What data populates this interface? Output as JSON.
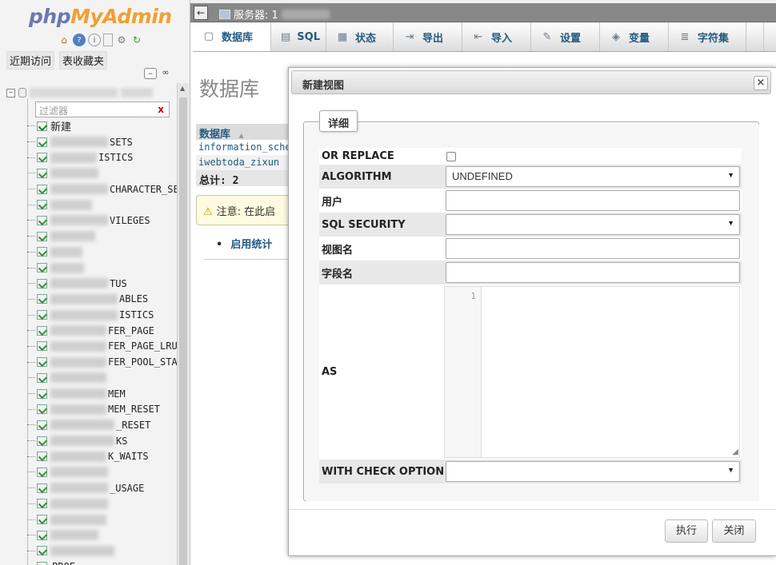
{
  "nav": {
    "logo_php": "php",
    "logo_admin": "MyAdmin",
    "icons": [
      "home-icon",
      "help-icon",
      "info-icon",
      "docs-icon",
      "settings-icon",
      "reload-icon"
    ],
    "links": [
      "近期访问",
      "表收藏夹"
    ],
    "filter_placeholder": "过滤器",
    "filter_clear": "x",
    "new_label": "新建",
    "tables": [
      {
        "visible_suffix": "SETS",
        "blur_width": 72
      },
      {
        "visible_suffix": "ISTICS",
        "blur_width": 58
      },
      {
        "visible_suffix": "",
        "blur_width": 60
      },
      {
        "visible_suffix": "CHARACTER_SE",
        "blur_width": 72
      },
      {
        "visible_suffix": "",
        "blur_width": 52
      },
      {
        "visible_suffix": "VILEGES",
        "blur_width": 72
      },
      {
        "visible_suffix": "",
        "blur_width": 56
      },
      {
        "visible_suffix": "",
        "blur_width": 40
      },
      {
        "visible_suffix": "",
        "blur_width": 42
      },
      {
        "visible_suffix": "TUS",
        "blur_width": 72
      },
      {
        "visible_suffix": "ABLES",
        "blur_width": 84
      },
      {
        "visible_suffix": "ISTICS",
        "blur_width": 84
      },
      {
        "visible_suffix": "FER_PAGE",
        "blur_width": 70
      },
      {
        "visible_suffix": "FER_PAGE_LRU",
        "blur_width": 70
      },
      {
        "visible_suffix": "FER_POOL_STA",
        "blur_width": 70
      },
      {
        "visible_suffix": "",
        "blur_width": 70
      },
      {
        "visible_suffix": "MEM",
        "blur_width": 70
      },
      {
        "visible_suffix": "MEM_RESET",
        "blur_width": 70
      },
      {
        "visible_suffix": "_RESET",
        "blur_width": 80
      },
      {
        "visible_suffix": "KS",
        "blur_width": 80
      },
      {
        "visible_suffix": "K_WAITS",
        "blur_width": 70
      },
      {
        "visible_suffix": "",
        "blur_width": 72
      },
      {
        "visible_suffix": "_USAGE",
        "blur_width": 72
      },
      {
        "visible_suffix": "",
        "blur_width": 72
      },
      {
        "visible_suffix": "",
        "blur_width": 70
      },
      {
        "visible_suffix": "",
        "blur_width": 60
      },
      {
        "visible_suffix": "",
        "blur_width": 80
      },
      {
        "visible_suffix": "PROF",
        "blur_width": 0
      }
    ]
  },
  "topbar": {
    "back_arrow": "←",
    "server_label": "服务器: 1"
  },
  "menu": {
    "tabs": [
      {
        "label": "数据库",
        "icon": "database-icon",
        "glyph": "▢"
      },
      {
        "label": "SQL",
        "icon": "sql-icon",
        "glyph": "▤"
      },
      {
        "label": "状态",
        "icon": "status-icon",
        "glyph": "▦"
      },
      {
        "label": "导出",
        "icon": "export-icon",
        "glyph": "⇥"
      },
      {
        "label": "导入",
        "icon": "import-icon",
        "glyph": "⇤"
      },
      {
        "label": "设置",
        "icon": "wrench-icon",
        "glyph": "✎"
      },
      {
        "label": "变量",
        "icon": "variables-icon",
        "glyph": "◈"
      },
      {
        "label": "字符集",
        "icon": "charset-icon",
        "glyph": "≣"
      }
    ]
  },
  "page": {
    "title": "数据库",
    "db_header": "数据库",
    "sort_arrow": "▲",
    "db_rows": [
      "information_sche",
      "iwebtoda_zixun"
    ],
    "total": "总计: 2",
    "notice": "注意: 在此启",
    "stat_bullet": "•",
    "stat_link": "启用统计"
  },
  "dialog": {
    "title": "新建视图",
    "close": "×",
    "legend": "详细",
    "rows": {
      "or_replace": "OR REPLACE",
      "algorithm": "ALGORITHM",
      "algorithm_value": "UNDEFINED",
      "user": "用户",
      "sql_security": "SQL SECURITY",
      "view_name": "视图名",
      "field_names": "字段名",
      "as": "AS",
      "with_check_option": "WITH CHECK OPTION"
    },
    "caret": "▼",
    "line_number": "1",
    "resize_glyph": "◢",
    "buttons": {
      "execute": "执行",
      "close": "关闭"
    }
  }
}
